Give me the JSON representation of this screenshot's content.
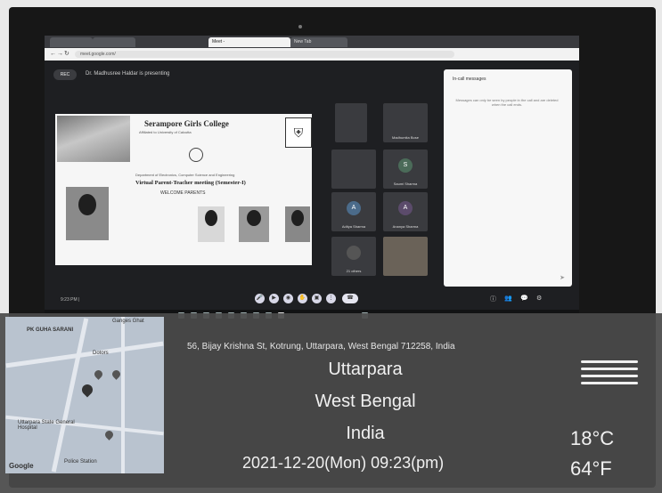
{
  "browser": {
    "tabs": [
      "",
      "",
      "Meet - ",
      "New Tab"
    ],
    "url": "meet.google.com/"
  },
  "meeting": {
    "rec_label": "REC",
    "presenting": "Dr. Madhusree Haldar is presenting",
    "time_code": "9:23 PM | ",
    "chat_title": "In-call messages",
    "chat_note": "Messages can only be seen by people in the call and are deleted when the call ends.",
    "participants": [
      {
        "name": "",
        "avatar": "",
        "color": "#6d6d6d"
      },
      {
        "name": "Madhumita Bose",
        "avatar": "",
        "color": "#5b5b5b"
      },
      {
        "name": "",
        "avatar": "",
        "color": "#707070"
      },
      {
        "name": "Saumi Sharma",
        "avatar": "S",
        "color": "#4b6b59"
      },
      {
        "name": "Aditya Sharma",
        "avatar": "A",
        "color": "#4b6b8a"
      },
      {
        "name": "Ananya Sharma",
        "avatar": "A",
        "color": "#5b4b6b"
      },
      {
        "name": "21 others",
        "avatar": "",
        "color": "#3a3b3f"
      },
      {
        "name": "",
        "avatar": "",
        "color": "#555555"
      }
    ]
  },
  "slide": {
    "college": "Serampore Girls College",
    "subtitle": "Affiliated to University of Calcutta",
    "department": "Department of Electronics, Computer Science and Engineering",
    "title": "Virtual Parent-Teacher meeting (Semester-I)",
    "welcome": "WELCOME PARENTS"
  },
  "gps": {
    "address": "56, Bijay Krishna St, Kotrung, Uttarpara, West Bengal 712258, India",
    "city": "Uttarpara",
    "state": "West Bengal",
    "country": "India",
    "datetime": "2021-12-20(Mon)  09:23(pm)",
    "temp_c": "18°C",
    "temp_f": "64°F",
    "weather_icon": "haze-waves-icon"
  },
  "map": {
    "labels": [
      "PK GUHA SARANI",
      "Ganges Ghat",
      "Dotors",
      "Uttarpara State General Hospital",
      "Police Station"
    ],
    "brand": "Google"
  }
}
